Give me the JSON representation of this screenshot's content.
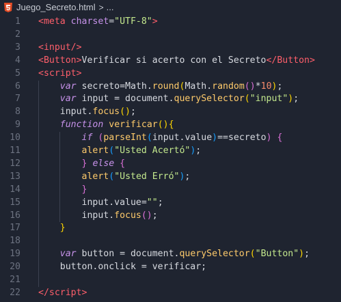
{
  "breadcrumb": {
    "file_icon": "html5-icon",
    "file": "Juego_Secreto.html",
    "separator": ">",
    "ellipsis": "..."
  },
  "lines": [
    {
      "n": "1",
      "tokens": [
        [
          "t-tag",
          "<meta "
        ],
        [
          "t-attr",
          "charset"
        ],
        [
          "t-punct",
          "="
        ],
        [
          "t-str",
          "\"UTF-8\""
        ],
        [
          "t-tag",
          ">"
        ]
      ]
    },
    {
      "n": "2",
      "tokens": []
    },
    {
      "n": "3",
      "tokens": [
        [
          "t-tag",
          "<input/>"
        ]
      ]
    },
    {
      "n": "4",
      "tokens": [
        [
          "t-tag",
          "<Button>"
        ],
        [
          "t-text",
          "Verificar si acerto con el Secreto"
        ],
        [
          "t-tag",
          "</Button>"
        ]
      ]
    },
    {
      "n": "5",
      "tokens": [
        [
          "t-tag",
          "<script>"
        ]
      ]
    },
    {
      "n": "6",
      "tokens": [
        [
          "t-text",
          "    "
        ],
        [
          "t-kw",
          "var"
        ],
        [
          "t-text",
          " secreto="
        ],
        [
          "t-var",
          "Math"
        ],
        [
          "t-punct",
          "."
        ],
        [
          "t-fn",
          "round"
        ],
        [
          "t-brace1",
          "("
        ],
        [
          "t-var",
          "Math"
        ],
        [
          "t-punct",
          "."
        ],
        [
          "t-fn",
          "random"
        ],
        [
          "t-brace2",
          "()"
        ],
        [
          "t-punct",
          "*"
        ],
        [
          "t-num",
          "10"
        ],
        [
          "t-brace1",
          ")"
        ],
        [
          "t-punct",
          ";"
        ]
      ]
    },
    {
      "n": "7",
      "tokens": [
        [
          "t-text",
          "    "
        ],
        [
          "t-kw",
          "var"
        ],
        [
          "t-text",
          " input = document."
        ],
        [
          "t-fn",
          "querySelector"
        ],
        [
          "t-brace1",
          "("
        ],
        [
          "t-str",
          "\"input\""
        ],
        [
          "t-brace1",
          ")"
        ],
        [
          "t-punct",
          ";"
        ]
      ]
    },
    {
      "n": "8",
      "tokens": [
        [
          "t-text",
          "    input."
        ],
        [
          "t-fn",
          "focus"
        ],
        [
          "t-brace1",
          "()"
        ],
        [
          "t-punct",
          ";"
        ]
      ]
    },
    {
      "n": "9",
      "tokens": [
        [
          "t-text",
          "    "
        ],
        [
          "t-kw",
          "function"
        ],
        [
          "t-text",
          " "
        ],
        [
          "t-fn",
          "verificar"
        ],
        [
          "t-brace1",
          "()"
        ],
        [
          "t-brace1",
          "{"
        ]
      ]
    },
    {
      "n": "10",
      "tokens": [
        [
          "t-text",
          "        "
        ],
        [
          "t-kw",
          "if"
        ],
        [
          "t-text",
          " "
        ],
        [
          "t-brace2",
          "("
        ],
        [
          "t-fn",
          "parseInt"
        ],
        [
          "t-brace3",
          "("
        ],
        [
          "t-text",
          "input.value"
        ],
        [
          "t-brace3",
          ")"
        ],
        [
          "t-text",
          "==secreto"
        ],
        [
          "t-brace2",
          ")"
        ],
        [
          "t-text",
          " "
        ],
        [
          "t-brace2",
          "{"
        ]
      ]
    },
    {
      "n": "11",
      "tokens": [
        [
          "t-text",
          "        "
        ],
        [
          "t-fn",
          "alert"
        ],
        [
          "t-brace3",
          "("
        ],
        [
          "t-str",
          "\"Usted Acertó\""
        ],
        [
          "t-brace3",
          ")"
        ],
        [
          "t-punct",
          ";"
        ]
      ]
    },
    {
      "n": "12",
      "tokens": [
        [
          "t-text",
          "        "
        ],
        [
          "t-brace2",
          "}"
        ],
        [
          "t-text",
          " "
        ],
        [
          "t-kw",
          "else"
        ],
        [
          "t-text",
          " "
        ],
        [
          "t-brace2",
          "{"
        ]
      ]
    },
    {
      "n": "13",
      "tokens": [
        [
          "t-text",
          "        "
        ],
        [
          "t-fn",
          "alert"
        ],
        [
          "t-brace3",
          "("
        ],
        [
          "t-str",
          "\"Usted Erró\""
        ],
        [
          "t-brace3",
          ")"
        ],
        [
          "t-punct",
          ";"
        ]
      ]
    },
    {
      "n": "14",
      "tokens": [
        [
          "t-text",
          "        "
        ],
        [
          "t-brace2",
          "}"
        ]
      ]
    },
    {
      "n": "15",
      "tokens": [
        [
          "t-text",
          "        input.value="
        ],
        [
          "t-str",
          "\"\""
        ],
        [
          "t-punct",
          ";"
        ]
      ]
    },
    {
      "n": "16",
      "tokens": [
        [
          "t-text",
          "        input."
        ],
        [
          "t-fn",
          "focus"
        ],
        [
          "t-brace2",
          "()"
        ],
        [
          "t-punct",
          ";"
        ]
      ]
    },
    {
      "n": "17",
      "tokens": [
        [
          "t-text",
          "    "
        ],
        [
          "t-brace1",
          "}"
        ]
      ]
    },
    {
      "n": "18",
      "tokens": []
    },
    {
      "n": "19",
      "tokens": [
        [
          "t-text",
          "    "
        ],
        [
          "t-kw",
          "var"
        ],
        [
          "t-text",
          " button = document."
        ],
        [
          "t-fn",
          "querySelector"
        ],
        [
          "t-brace1",
          "("
        ],
        [
          "t-str",
          "\"Button\""
        ],
        [
          "t-brace1",
          ")"
        ],
        [
          "t-punct",
          ";"
        ]
      ]
    },
    {
      "n": "20",
      "tokens": [
        [
          "t-text",
          "    button.onclick = verificar;"
        ]
      ]
    },
    {
      "n": "21",
      "tokens": []
    },
    {
      "n": "22",
      "tokens": [
        [
          "t-tag",
          "</"
        ],
        [
          "t-tag",
          "script"
        ],
        [
          "t-tag",
          ">"
        ]
      ]
    }
  ],
  "colors": {
    "background": "#1f2430",
    "tag": "#ff5f6b",
    "keyword": "#c792ea",
    "string": "#c3e88d",
    "function": "#ffcb6b",
    "number": "#f78c6c",
    "html_icon": "#e44d26"
  }
}
